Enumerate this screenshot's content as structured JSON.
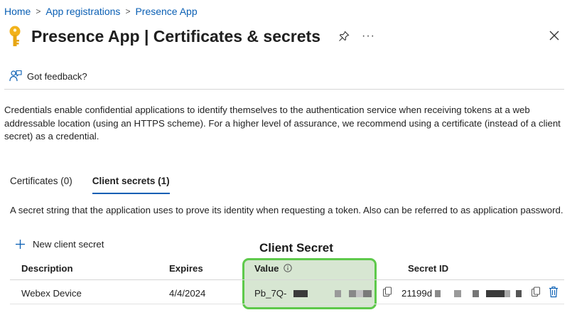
{
  "breadcrumb": {
    "items": [
      "Home",
      "App registrations",
      "Presence App"
    ],
    "separator": ">"
  },
  "header": {
    "app_name": "Presence App",
    "divider": "|",
    "section": "Certificates & secrets",
    "more_label": "···",
    "icons": [
      "key-icon",
      "pin-icon",
      "more-icon",
      "close-icon"
    ]
  },
  "feedback": {
    "label": "Got feedback?"
  },
  "description": "Credentials enable confidential applications to identify themselves to the authentication service when receiving tokens at a web addressable location (using an HTTPS scheme). For a higher level of assurance, we recommend using a certificate (instead of a client secret) as a credential.",
  "tabs": [
    {
      "label": "Certificates (0)",
      "active": false
    },
    {
      "label": "Client secrets (1)",
      "active": true
    }
  ],
  "client_secrets": {
    "description": "A secret string that the application uses to prove its identity when requesting a token. Also can be referred to as application password.",
    "new_button": "New client secret",
    "columns": [
      "Description",
      "Expires",
      "Value",
      "Secret ID"
    ],
    "rows": [
      {
        "description": "Webex Device",
        "expires": "4/4/2024",
        "value": "Pb_7Q-",
        "secret_id": "21199d"
      }
    ]
  },
  "annotation": {
    "label": "Client Secret",
    "color": "#5ec94b"
  },
  "colors": {
    "link": "#0a5fb4",
    "key": "#f2b21b",
    "highlight_border": "#5ec94b"
  }
}
